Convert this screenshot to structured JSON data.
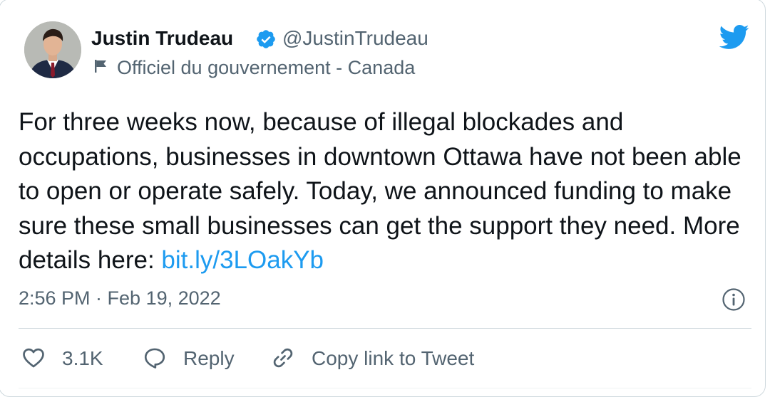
{
  "author": {
    "name": "Justin Trudeau",
    "handle": "@JustinTrudeau",
    "label": "Officiel du gouvernement - Canada",
    "verified": true
  },
  "tweet": {
    "text": "For three weeks now, because of illegal blockades and occupations, businesses in downtown Ottawa have not been able to open or operate safely. Today, we announced funding to make sure these small businesses can get the support they need. More details here: ",
    "link": "bit.ly/3LOakYb",
    "timestamp": "2:56 PM · Feb 19, 2022"
  },
  "actions": {
    "like_count": "3.1K",
    "reply_label": "Reply",
    "copy_label": "Copy link to Tweet"
  },
  "icons": {
    "brand": "twitter-bird-icon",
    "verified": "verified-badge-icon",
    "label": "flag-icon",
    "info": "info-icon",
    "like": "heart-icon",
    "reply": "speech-bubble-icon",
    "copy": "link-icon"
  },
  "colors": {
    "accent": "#1d9bf0",
    "text": "#0f1419",
    "secondary": "#536471",
    "divider": "#cfd9de"
  }
}
